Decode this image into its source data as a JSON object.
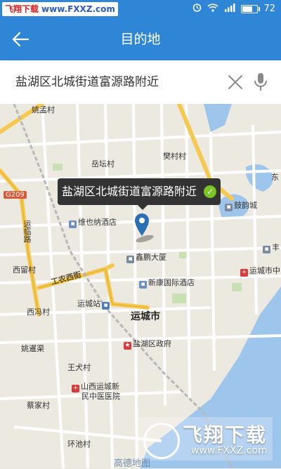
{
  "status_bar": {
    "watermark_red": "飞翔下载",
    "watermark_site": "www.FXXZ.com",
    "battery": "72"
  },
  "header": {
    "title": "目的地",
    "back_icon": "arrow-left-icon"
  },
  "search": {
    "query": "盐湖区北城街道富源路附近",
    "clear_icon": "close-icon",
    "mic_icon": "microphone-icon"
  },
  "map": {
    "callout_text": "盐湖区北城街道富源路附近",
    "city_label": "运城市",
    "map_logo": "高德地图",
    "labels": {
      "l1": "姚孟村",
      "l2": "岳坛村",
      "l3": "樊村村",
      "l4": "东",
      "l5": "G209",
      "l6": "运临路",
      "l7": "维也纳酒店",
      "l8": "鼓韵城",
      "l9": "西留村",
      "l10": "鑫鹏大厦",
      "l11": "运城市中",
      "l12": "工农西街",
      "l13": "新康国际酒店",
      "l14": "西冯村",
      "l15": "运城站",
      "l16": "盐湖区政府",
      "l17": "姚暹渠",
      "l18": "王犬村",
      "l19": "山西运城新",
      "l20": "民中医医院",
      "l21": "蔡家村",
      "l22": "环池村",
      "l23": "丰"
    }
  },
  "watermark_bottom": {
    "title": "飞翔下载",
    "url": "www.FXXZ.com"
  },
  "colors": {
    "header_blue": "#2f86d6",
    "water": "#9ec6ec",
    "road_yellow": "#f5c84f",
    "callout_bg": "#333333",
    "check_green": "#7cc324",
    "pin_blue": "#2c6fb5"
  }
}
